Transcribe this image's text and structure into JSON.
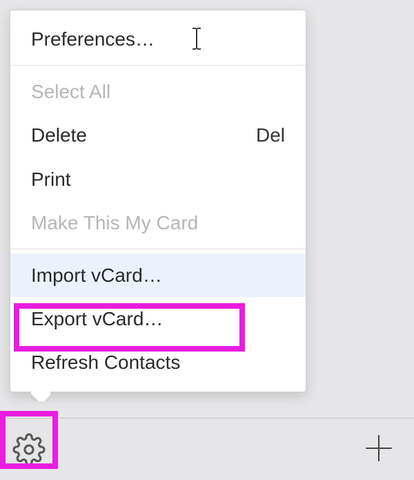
{
  "menu": {
    "preferences": "Preferences…",
    "select_all": "Select All",
    "delete": "Delete",
    "delete_shortcut": "Del",
    "print": "Print",
    "make_card": "Make This My Card",
    "import_vcard": "Import vCard…",
    "export_vcard": "Export vCard…",
    "refresh": "Refresh Contacts"
  },
  "annotation_color": "#e81de0"
}
